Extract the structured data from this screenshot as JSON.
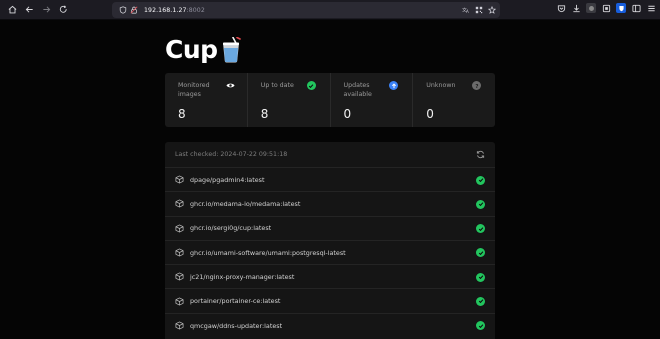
{
  "browser": {
    "url_host": "192.168.1.27",
    "url_port": ":8002"
  },
  "app": {
    "title": "Cup"
  },
  "stats": [
    {
      "label": "Monitored images",
      "value": "8",
      "icon": "eye-icon",
      "color": "#ffffff"
    },
    {
      "label": "Up to date",
      "value": "8",
      "icon": "check-circle-icon",
      "color": "#22c55e"
    },
    {
      "label": "Updates available",
      "value": "0",
      "icon": "arrow-up-circle-icon",
      "color": "#3b82f6"
    },
    {
      "label": "Unknown",
      "value": "0",
      "icon": "question-circle-icon",
      "color": "#6b6b6b"
    }
  ],
  "list": {
    "last_checked": "Last checked: 2024-07-22 09:51:18",
    "items": [
      {
        "name": "dpage/pgadmin4:latest",
        "status": "up-to-date"
      },
      {
        "name": "ghcr.io/medama-io/medama:latest",
        "status": "up-to-date"
      },
      {
        "name": "ghcr.io/sergi0g/cup:latest",
        "status": "up-to-date"
      },
      {
        "name": "ghcr.io/umami-software/umami:postgresql-latest",
        "status": "up-to-date"
      },
      {
        "name": "jc21/nginx-proxy-manager:latest",
        "status": "up-to-date"
      },
      {
        "name": "portainer/portainer-ce:latest",
        "status": "up-to-date"
      },
      {
        "name": "qmcgaw/ddns-updater:latest",
        "status": "up-to-date"
      }
    ]
  },
  "colors": {
    "success": "#22c55e",
    "info": "#3b82f6",
    "muted": "#6b6b6b"
  }
}
